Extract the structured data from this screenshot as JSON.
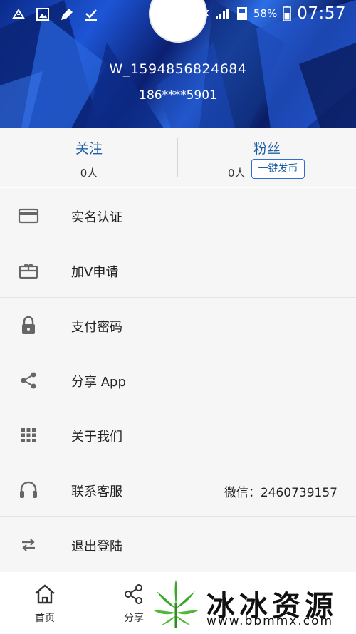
{
  "status_bar": {
    "network": "1X",
    "battery": "58%",
    "time": "07:57"
  },
  "profile": {
    "username": "W_1594856824684",
    "phone": "186****5901"
  },
  "stats": {
    "following_label": "关注",
    "following_count": "0人",
    "fans_label": "粉丝",
    "fans_count": "0人",
    "issue_button": "一键发币"
  },
  "menu": {
    "items": [
      {
        "label": "实名认证",
        "icon": "id-card-icon"
      },
      {
        "label": "加V申请",
        "icon": "gift-icon"
      },
      {
        "label": "支付密码",
        "icon": "lock-icon"
      },
      {
        "label": "分享 App",
        "icon": "share-icon"
      },
      {
        "label": "关于我们",
        "icon": "grid-icon"
      },
      {
        "label": "联系客服",
        "icon": "headset-icon",
        "value": "微信：2460739157"
      },
      {
        "label": "退出登陆",
        "icon": "swap-icon"
      }
    ]
  },
  "bottom_nav": {
    "home_label": "首页",
    "share_label": "分享"
  },
  "watermark": {
    "text": "冰冰资源网",
    "url": "www.bbmmx.com"
  },
  "colors": {
    "accent": "#1f5fa6",
    "header_blue": "#1d55d6",
    "background": "#f6f6f6"
  }
}
